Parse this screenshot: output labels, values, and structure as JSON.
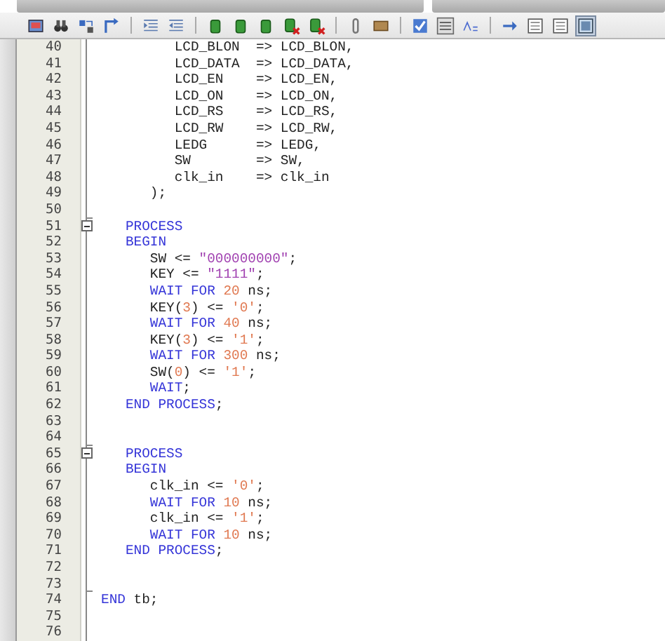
{
  "toolbar": {
    "buttons": [
      {
        "kind": "screen"
      },
      {
        "kind": "binoculars"
      },
      {
        "kind": "replace"
      },
      {
        "kind": "goto"
      },
      {
        "kind": "sep"
      },
      {
        "kind": "indent"
      },
      {
        "kind": "outdent"
      },
      {
        "kind": "sep"
      },
      {
        "kind": "bookmark"
      },
      {
        "kind": "bookmark"
      },
      {
        "kind": "bookmark"
      },
      {
        "kind": "bookmark-x"
      },
      {
        "kind": "bookmark-x"
      },
      {
        "kind": "sep"
      },
      {
        "kind": "clip"
      },
      {
        "kind": "scroll"
      },
      {
        "kind": "sep"
      },
      {
        "kind": "check"
      },
      {
        "kind": "counter"
      },
      {
        "kind": "spell"
      },
      {
        "kind": "sep"
      },
      {
        "kind": "arrow"
      },
      {
        "kind": "panel"
      },
      {
        "kind": "panel"
      },
      {
        "kind": "panel-on"
      }
    ]
  },
  "editor": {
    "lines": [
      {
        "number": "40",
        "collapsible": false,
        "block_end": false,
        "tokens": [
          {
            "kind": "plain",
            "text": "         LCD_BLON  => LCD_BLON,"
          }
        ]
      },
      {
        "number": "41",
        "collapsible": false,
        "block_end": false,
        "tokens": [
          {
            "kind": "plain",
            "text": "         LCD_DATA  => LCD_DATA,"
          }
        ]
      },
      {
        "number": "42",
        "collapsible": false,
        "block_end": false,
        "tokens": [
          {
            "kind": "plain",
            "text": "         LCD_EN    => LCD_EN,"
          }
        ]
      },
      {
        "number": "43",
        "collapsible": false,
        "block_end": false,
        "tokens": [
          {
            "kind": "plain",
            "text": "         LCD_ON    => LCD_ON,"
          }
        ]
      },
      {
        "number": "44",
        "collapsible": false,
        "block_end": false,
        "tokens": [
          {
            "kind": "plain",
            "text": "         LCD_RS    => LCD_RS,"
          }
        ]
      },
      {
        "number": "45",
        "collapsible": false,
        "block_end": false,
        "tokens": [
          {
            "kind": "plain",
            "text": "         LCD_RW    => LCD_RW,"
          }
        ]
      },
      {
        "number": "46",
        "collapsible": false,
        "block_end": false,
        "tokens": [
          {
            "kind": "plain",
            "text": "         LEDG      => LEDG,"
          }
        ]
      },
      {
        "number": "47",
        "collapsible": false,
        "block_end": false,
        "tokens": [
          {
            "kind": "plain",
            "text": "         SW        => SW,"
          }
        ]
      },
      {
        "number": "48",
        "collapsible": false,
        "block_end": false,
        "tokens": [
          {
            "kind": "plain",
            "text": "         clk_in    => clk_in"
          }
        ]
      },
      {
        "number": "49",
        "collapsible": false,
        "block_end": false,
        "tokens": [
          {
            "kind": "plain",
            "text": "      );"
          }
        ]
      },
      {
        "number": "50",
        "collapsible": false,
        "block_end": true
      },
      {
        "number": "51",
        "collapsible": true,
        "block_end": false,
        "tokens": [
          {
            "kind": "keyword",
            "text": "   PROCESS"
          }
        ]
      },
      {
        "number": "52",
        "collapsible": false,
        "block_end": false,
        "tokens": [
          {
            "kind": "keyword",
            "text": "   BEGIN"
          }
        ]
      },
      {
        "number": "53",
        "collapsible": false,
        "block_end": false,
        "tokens": [
          {
            "kind": "plain",
            "text": "      SW <= "
          },
          {
            "kind": "string",
            "text": "\"000000000\""
          },
          {
            "kind": "plain",
            "text": ";"
          }
        ]
      },
      {
        "number": "54",
        "collapsible": false,
        "block_end": false,
        "tokens": [
          {
            "kind": "plain",
            "text": "      KEY <= "
          },
          {
            "kind": "string",
            "text": "\"1111\""
          },
          {
            "kind": "plain",
            "text": ";"
          }
        ]
      },
      {
        "number": "55",
        "collapsible": false,
        "block_end": false,
        "tokens": [
          {
            "kind": "keyword",
            "text": "      WAIT FOR "
          },
          {
            "kind": "literal",
            "text": "20"
          },
          {
            "kind": "plain",
            "text": " ns;"
          }
        ]
      },
      {
        "number": "56",
        "collapsible": false,
        "block_end": false,
        "tokens": [
          {
            "kind": "plain",
            "text": "      KEY("
          },
          {
            "kind": "literal",
            "text": "3"
          },
          {
            "kind": "plain",
            "text": ") <= "
          },
          {
            "kind": "literal",
            "text": "'0'"
          },
          {
            "kind": "plain",
            "text": ";"
          }
        ]
      },
      {
        "number": "57",
        "collapsible": false,
        "block_end": false,
        "tokens": [
          {
            "kind": "keyword",
            "text": "      WAIT FOR "
          },
          {
            "kind": "literal",
            "text": "40"
          },
          {
            "kind": "plain",
            "text": " ns;"
          }
        ]
      },
      {
        "number": "58",
        "collapsible": false,
        "block_end": false,
        "tokens": [
          {
            "kind": "plain",
            "text": "      KEY("
          },
          {
            "kind": "literal",
            "text": "3"
          },
          {
            "kind": "plain",
            "text": ") <= "
          },
          {
            "kind": "literal",
            "text": "'1'"
          },
          {
            "kind": "plain",
            "text": ";"
          }
        ]
      },
      {
        "number": "59",
        "collapsible": false,
        "block_end": false,
        "tokens": [
          {
            "kind": "keyword",
            "text": "      WAIT FOR "
          },
          {
            "kind": "literal",
            "text": "300"
          },
          {
            "kind": "plain",
            "text": " ns;"
          }
        ]
      },
      {
        "number": "60",
        "collapsible": false,
        "block_end": false,
        "tokens": [
          {
            "kind": "plain",
            "text": "      SW("
          },
          {
            "kind": "literal",
            "text": "0"
          },
          {
            "kind": "plain",
            "text": ") <= "
          },
          {
            "kind": "literal",
            "text": "'1'"
          },
          {
            "kind": "plain",
            "text": ";"
          }
        ]
      },
      {
        "number": "61",
        "collapsible": false,
        "block_end": false,
        "tokens": [
          {
            "kind": "keyword",
            "text": "      WAIT"
          },
          {
            "kind": "plain",
            "text": ";"
          }
        ]
      },
      {
        "number": "62",
        "collapsible": false,
        "block_end": false,
        "tokens": [
          {
            "kind": "keyword",
            "text": "   END PROCESS"
          },
          {
            "kind": "plain",
            "text": ";"
          }
        ]
      },
      {
        "number": "63",
        "collapsible": false,
        "block_end": false
      },
      {
        "number": "64",
        "collapsible": false,
        "block_end": true
      },
      {
        "number": "65",
        "collapsible": true,
        "block_end": false,
        "tokens": [
          {
            "kind": "keyword",
            "text": "   PROCESS"
          }
        ]
      },
      {
        "number": "66",
        "collapsible": false,
        "block_end": false,
        "tokens": [
          {
            "kind": "keyword",
            "text": "   BEGIN"
          }
        ]
      },
      {
        "number": "67",
        "collapsible": false,
        "block_end": false,
        "tokens": [
          {
            "kind": "plain",
            "text": "      clk_in <= "
          },
          {
            "kind": "literal",
            "text": "'0'"
          },
          {
            "kind": "plain",
            "text": ";"
          }
        ]
      },
      {
        "number": "68",
        "collapsible": false,
        "block_end": false,
        "tokens": [
          {
            "kind": "keyword",
            "text": "      WAIT FOR "
          },
          {
            "kind": "literal",
            "text": "10"
          },
          {
            "kind": "plain",
            "text": " ns;"
          }
        ]
      },
      {
        "number": "69",
        "collapsible": false,
        "block_end": false,
        "tokens": [
          {
            "kind": "plain",
            "text": "      clk_in <= "
          },
          {
            "kind": "literal",
            "text": "'1'"
          },
          {
            "kind": "plain",
            "text": ";"
          }
        ]
      },
      {
        "number": "70",
        "collapsible": false,
        "block_end": false,
        "tokens": [
          {
            "kind": "keyword",
            "text": "      WAIT FOR "
          },
          {
            "kind": "literal",
            "text": "10"
          },
          {
            "kind": "plain",
            "text": " ns;"
          }
        ]
      },
      {
        "number": "71",
        "collapsible": false,
        "block_end": false,
        "tokens": [
          {
            "kind": "keyword",
            "text": "   END PROCESS"
          },
          {
            "kind": "plain",
            "text": ";"
          }
        ]
      },
      {
        "number": "72",
        "collapsible": false,
        "block_end": false
      },
      {
        "number": "73",
        "collapsible": false,
        "block_end": true
      },
      {
        "number": "74",
        "collapsible": false,
        "block_end": false,
        "tokens": [
          {
            "kind": "keyword",
            "text": "END"
          },
          {
            "kind": "plain",
            "text": " tb;"
          }
        ]
      },
      {
        "number": "75",
        "collapsible": false,
        "block_end": false
      },
      {
        "number": "76",
        "collapsible": false,
        "block_end": false
      }
    ]
  }
}
